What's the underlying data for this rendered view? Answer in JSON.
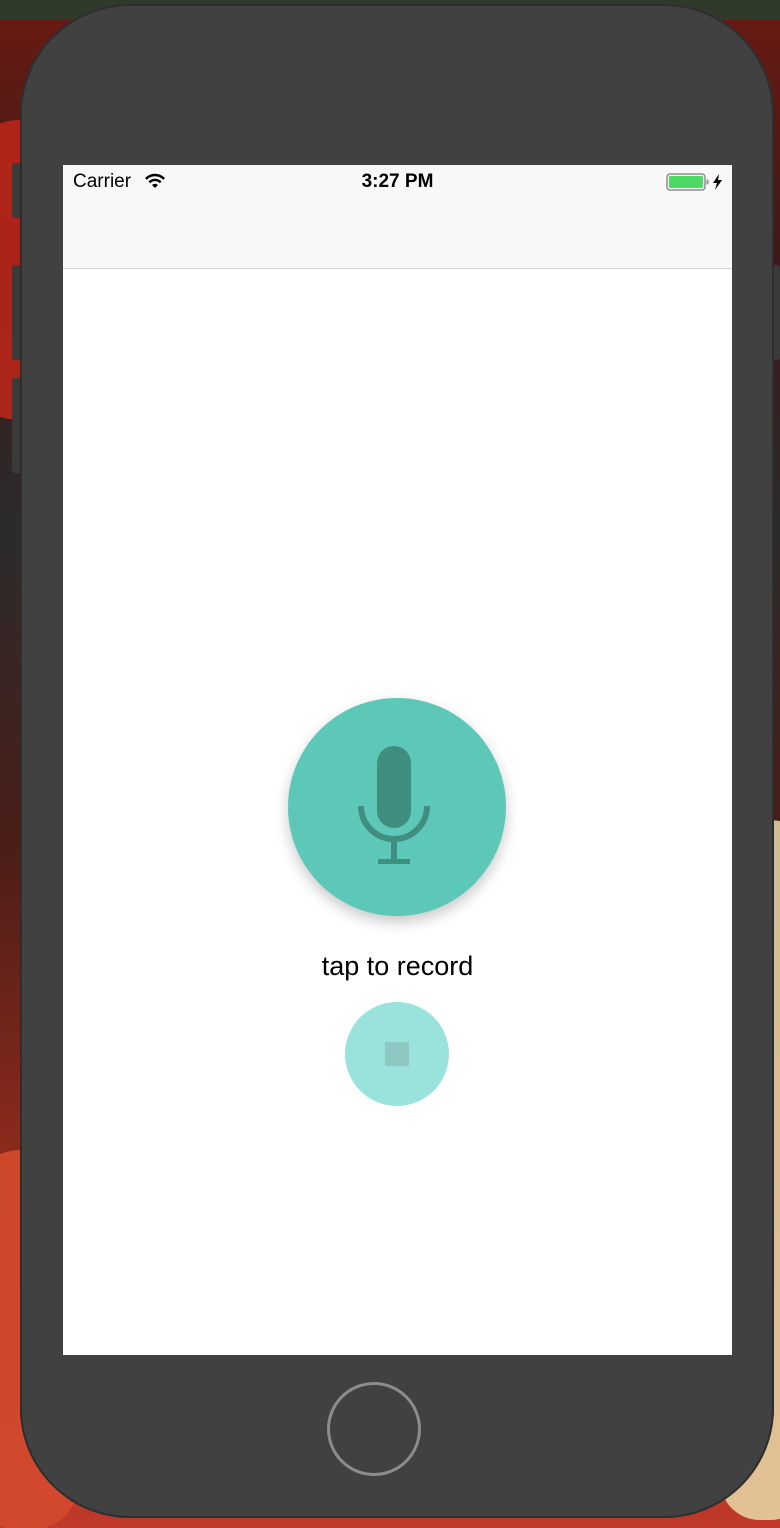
{
  "status_bar": {
    "carrier": "Carrier",
    "time": "3:27 PM",
    "wifi_icon": "wifi-icon",
    "battery_icon": "battery-charging-icon",
    "battery_color": "#4cd964"
  },
  "main": {
    "record_button": {
      "icon": "microphone-icon",
      "color": "#5dc8b8",
      "icon_color": "#3f8e80"
    },
    "record_label": "tap to record",
    "stop_button": {
      "icon": "stop-icon",
      "color": "#9ae3dc"
    }
  },
  "device": {
    "home_button_icon": "home-button"
  }
}
